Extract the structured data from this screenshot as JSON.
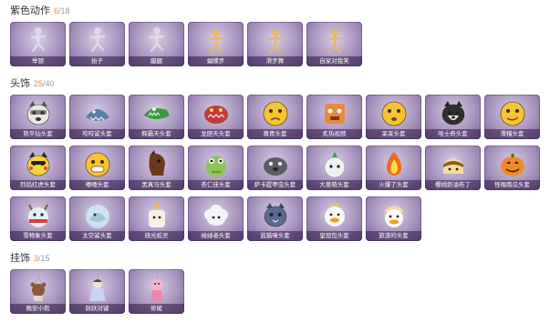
{
  "sections": [
    {
      "id": "purple-actions",
      "title": "紫色动作",
      "owned": "6",
      "total": "/18",
      "items": [
        {
          "label": "举颈",
          "icon": "ghost-skeleton-icon"
        },
        {
          "label": "抬子",
          "icon": "ghost-dancer-icon"
        },
        {
          "label": "蹦腿",
          "icon": "ghost-runner-icon"
        },
        {
          "label": "蝠蝶步",
          "icon": "gold-dancer-icon"
        },
        {
          "label": "滑步舞",
          "icon": "gold-skater-icon"
        },
        {
          "label": "自家对我笑",
          "icon": "gold-waver-icon"
        }
      ]
    },
    {
      "id": "headwear",
      "title": "头饰",
      "owned": "25",
      "total": "/40",
      "items": [
        {
          "label": "熊平仙头套",
          "icon": "raccoon-head-icon"
        },
        {
          "label": "咬咬鲨头套",
          "icon": "shark-head-icon"
        },
        {
          "label": "鳄霸天头套",
          "icon": "crocodile-head-icon"
        },
        {
          "label": "龙胆天头套",
          "icon": "dragon-head-icon"
        },
        {
          "label": "尊青头套",
          "icon": "sad-emoji-head-icon"
        },
        {
          "label": "炙热视频",
          "icon": "orange-box-head-icon"
        },
        {
          "label": "呆呆头套",
          "icon": "confused-emoji-head-icon"
        },
        {
          "label": "哈士奇头套",
          "icon": "husky-head-icon"
        },
        {
          "label": "滑稽头套",
          "icon": "smirk-emoji-head-icon"
        },
        {
          "label": "烈焰红虎头套",
          "icon": "pikachu-head-icon"
        },
        {
          "label": "嘻嘻头套",
          "icon": "grin-emoji-head-icon"
        },
        {
          "label": "黑真马头套",
          "icon": "horse-head-icon"
        },
        {
          "label": "杏仁佳头套",
          "icon": "frog-head-icon"
        },
        {
          "label": "萨卡提甲虫头套",
          "icon": "seal-head-icon"
        },
        {
          "label": "大葱萌头套",
          "icon": "radish-head-icon"
        },
        {
          "label": "火爆了头套",
          "icon": "fire-head-icon"
        },
        {
          "label": "樱桃奶油布丁",
          "icon": "pudding-head-icon"
        },
        {
          "label": "怪咖南瓜头套",
          "icon": "pumpkin-head-icon"
        },
        {
          "label": "雪物象头套",
          "icon": "reindeer-head-icon"
        },
        {
          "label": "太空鲨头套",
          "icon": "space-shark-head-icon"
        },
        {
          "label": "烧光蛇灵",
          "icon": "candle-head-icon"
        },
        {
          "label": "绒绒者头套",
          "icon": "cloud-sheep-head-icon"
        },
        {
          "label": "蓝猫咪头套",
          "icon": "blue-cat-head-icon"
        },
        {
          "label": "皇冠包头套",
          "icon": "duck-head-icon"
        },
        {
          "label": "旅游的头套",
          "icon": "goose-head-icon"
        }
      ]
    },
    {
      "id": "pendants",
      "title": "挂饰",
      "owned": "3",
      "total": "/15",
      "items": [
        {
          "label": "晚安小熊",
          "icon": "bear-keychain-icon"
        },
        {
          "label": "跃跃对键",
          "icon": "girl-keychain-icon"
        },
        {
          "label": "修尾",
          "icon": "pink-doll-keychain-icon"
        }
      ]
    }
  ]
}
